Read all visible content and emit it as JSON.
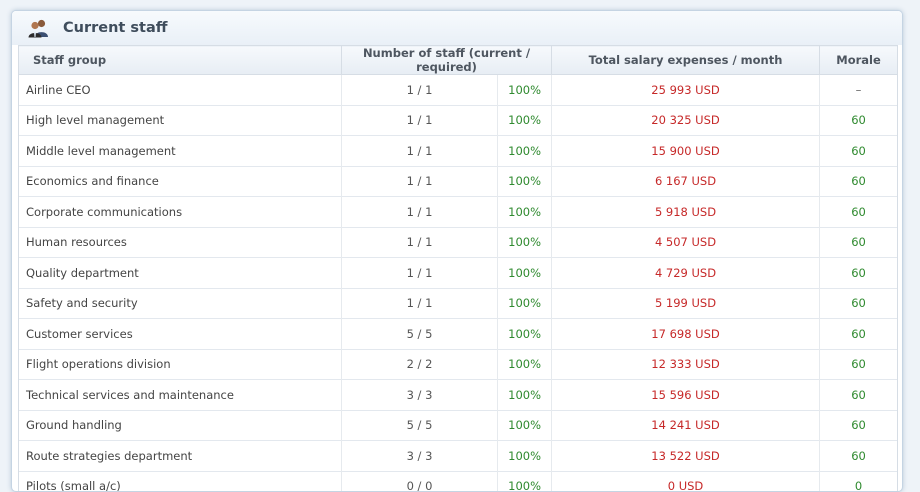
{
  "panel": {
    "title": "Current staff",
    "icon": "staff-group-icon"
  },
  "table": {
    "headers": {
      "staff_group": "Staff group",
      "number": "Number of staff (current / required)",
      "salary": "Total salary expenses / month",
      "morale": "Morale"
    },
    "rows": [
      {
        "group": "Airline CEO",
        "count": "1 / 1",
        "pct": "100%",
        "salary": "25 993 USD",
        "morale": "–"
      },
      {
        "group": "High level management",
        "count": "1 / 1",
        "pct": "100%",
        "salary": "20 325 USD",
        "morale": "60"
      },
      {
        "group": "Middle level management",
        "count": "1 / 1",
        "pct": "100%",
        "salary": "15 900 USD",
        "morale": "60"
      },
      {
        "group": "Economics and finance",
        "count": "1 / 1",
        "pct": "100%",
        "salary": "6 167 USD",
        "morale": "60"
      },
      {
        "group": "Corporate communications",
        "count": "1 / 1",
        "pct": "100%",
        "salary": "5 918 USD",
        "morale": "60"
      },
      {
        "group": "Human resources",
        "count": "1 / 1",
        "pct": "100%",
        "salary": "4 507 USD",
        "morale": "60"
      },
      {
        "group": "Quality department",
        "count": "1 / 1",
        "pct": "100%",
        "salary": "4 729 USD",
        "morale": "60"
      },
      {
        "group": "Safety and security",
        "count": "1 / 1",
        "pct": "100%",
        "salary": "5 199 USD",
        "morale": "60"
      },
      {
        "group": "Customer services",
        "count": "5 / 5",
        "pct": "100%",
        "salary": "17 698 USD",
        "morale": "60"
      },
      {
        "group": "Flight operations division",
        "count": "2 / 2",
        "pct": "100%",
        "salary": "12 333 USD",
        "morale": "60"
      },
      {
        "group": "Technical services and maintenance",
        "count": "3 / 3",
        "pct": "100%",
        "salary": "15 596 USD",
        "morale": "60"
      },
      {
        "group": "Ground handling",
        "count": "5 / 5",
        "pct": "100%",
        "salary": "14 241 USD",
        "morale": "60"
      },
      {
        "group": "Route strategies department",
        "count": "3 / 3",
        "pct": "100%",
        "salary": "13 522 USD",
        "morale": "60"
      },
      {
        "group": "Pilots (small a/c)",
        "count": "0 / 0",
        "pct": "100%",
        "salary": "0 USD",
        "morale": "0"
      }
    ]
  },
  "colors": {
    "positive": "#2f8a2f",
    "expense": "#c62828"
  }
}
